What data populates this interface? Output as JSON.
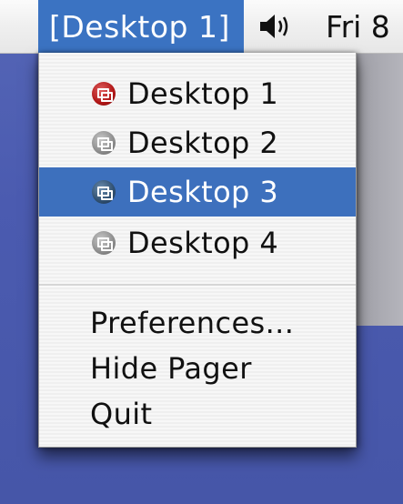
{
  "menubar": {
    "title": "[Desktop 1]",
    "clock": "Fri 8",
    "speaker_icon": "speaker-icon"
  },
  "menu": {
    "desktops": [
      {
        "label": "Desktop 1",
        "icon": "desktop-icon",
        "icon_color": "#b01616",
        "selected": false
      },
      {
        "label": "Desktop 2",
        "icon": "desktop-icon",
        "icon_color": "#8d8d8d",
        "selected": false
      },
      {
        "label": "Desktop 3",
        "icon": "desktop-icon",
        "icon_color": "#2f4f70",
        "selected": true
      },
      {
        "label": "Desktop 4",
        "icon": "desktop-icon",
        "icon_color": "#8d8d8d",
        "selected": false
      }
    ],
    "actions": [
      {
        "label": "Preferences..."
      },
      {
        "label": "Hide Pager"
      },
      {
        "label": "Quit"
      }
    ]
  },
  "colors": {
    "selection": "#3d70bd",
    "desktop_background": "#4d5eae"
  }
}
